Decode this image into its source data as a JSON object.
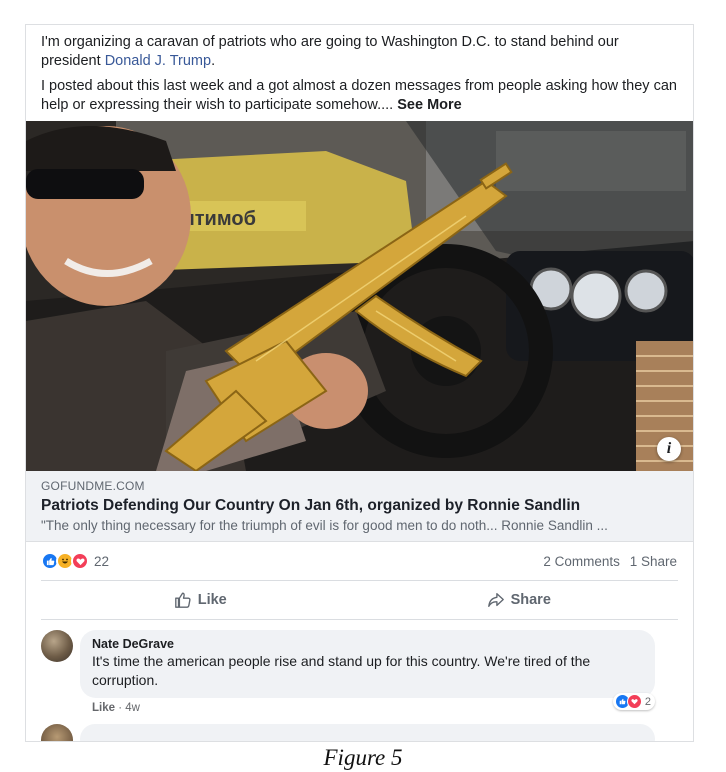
{
  "post": {
    "paragraph1_a": "I'm organizing a caravan of patriots who are going to Washington D.C. to stand behind our president ",
    "mention": "Donald J. Trump",
    "paragraph1_b": ".",
    "paragraph2": "I posted about this last week and a got almost a dozen messages from people asking how they can help or expressing their wish to participate somehow.... ",
    "see_more": "See More"
  },
  "photo": {
    "taxi_sign": "Ситимоб",
    "info_icon": "info-icon",
    "info_glyph": "i"
  },
  "link_preview": {
    "domain": "GOFUNDME.COM",
    "title": "Patriots Defending Our Country On Jan 6th, organized by Ronnie Sandlin",
    "description": "\"The only thing necessary for the triumph of evil is for good men to do noth... Ronnie Sandlin ..."
  },
  "stats": {
    "reaction_icons": [
      "like-reaction-icon",
      "haha-reaction-icon",
      "love-reaction-icon"
    ],
    "reaction_count": "22",
    "comments": "2 Comments",
    "shares": "1 Share"
  },
  "actions": {
    "like_label": "Like",
    "share_label": "Share"
  },
  "comment": {
    "author": "Nate DeGrave",
    "text": "It's time the american people rise and stand up for this country. We're tired of the corruption.",
    "reaction_count": "2",
    "like_link": "Like",
    "separator": " · ",
    "time": "4w"
  },
  "caption": "Figure 5",
  "colors": {
    "accent": "#385898",
    "like_blue": "#1877f2",
    "love_red": "#f33e58",
    "haha_yellow": "#f7b125"
  }
}
